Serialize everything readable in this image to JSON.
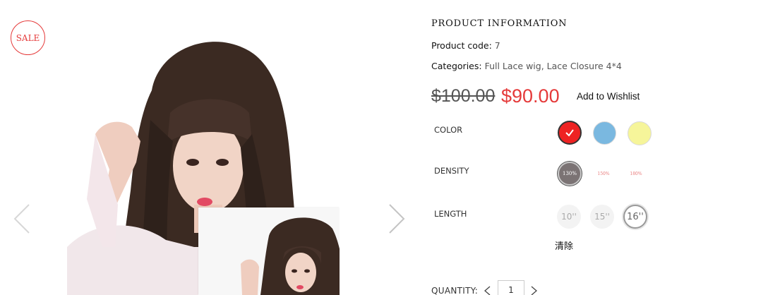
{
  "gallery": {
    "sale_badge": "SALE",
    "prev_icon": "chevron-left-icon",
    "next_icon": "chevron-right-icon"
  },
  "product": {
    "section_title": "PRODUCT INFORMATION",
    "code_label": "Product code:",
    "code_value": "7",
    "categories_label": "Categories:",
    "categories_value": "Full Lace wig, Lace Closure 4*4",
    "price_old": "$100.00",
    "price_new": "$90.00",
    "wishlist_label": "Add to Wishlist"
  },
  "attributes": {
    "color": {
      "label": "COLOR",
      "options": [
        {
          "name": "red",
          "hex": "#ee2222",
          "selected": true
        },
        {
          "name": "blue",
          "hex": "#7ab8e0",
          "selected": false
        },
        {
          "name": "yellow",
          "hex": "#f6f59a",
          "selected": false
        }
      ]
    },
    "density": {
      "label": "DENSITY",
      "options": [
        "130%",
        "150%",
        "180%"
      ],
      "selected": "130%"
    },
    "length": {
      "label": "LENGTH",
      "options": [
        "10''",
        "15''",
        "16''"
      ],
      "selected": "16''"
    },
    "clear_label": "清除"
  },
  "quantity": {
    "label": "QUANTITY:",
    "value": "1"
  },
  "colors": {
    "accent_red": "#e53a3a",
    "text_dark": "#111111"
  }
}
